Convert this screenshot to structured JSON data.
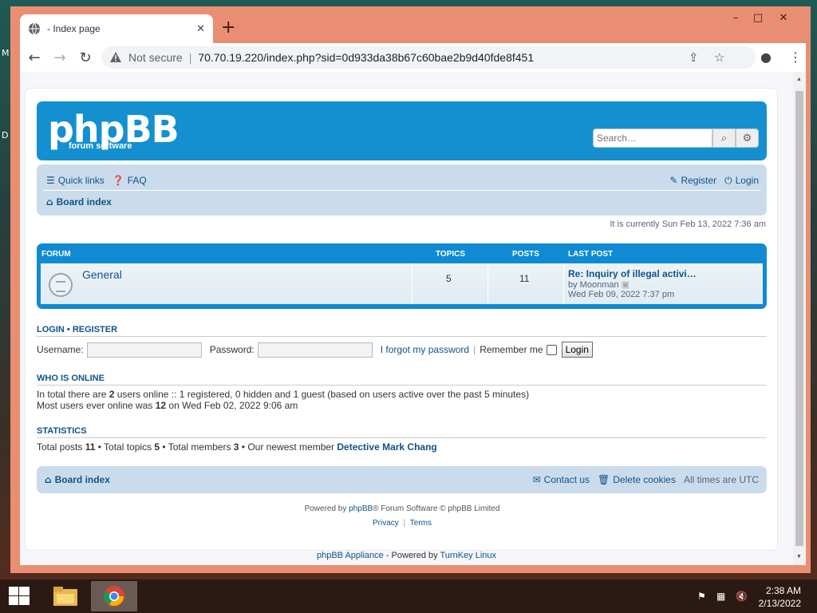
{
  "desktop": {
    "letters": [
      "M",
      "D"
    ]
  },
  "browser": {
    "tab_title": "- Index page",
    "security_label": "Not secure",
    "url": "70.70.19.220/index.php?sid=0d933da38b67c60bae2b9d40fde8f451",
    "window_controls": {
      "minimize": "–",
      "maximize": "□",
      "close": "✕"
    }
  },
  "header": {
    "logo_text": "phpBB",
    "logo_sub": "forum  software",
    "search_placeholder": "Search…"
  },
  "navbar": {
    "quick_links": "Quick links",
    "faq": "FAQ",
    "register": "Register",
    "login": "Login",
    "board_index": "Board index"
  },
  "current_time": "It is currently Sun Feb 13, 2022 7:36 am",
  "forum_table": {
    "headers": {
      "forum": "FORUM",
      "topics": "TOPICS",
      "posts": "POSTS",
      "last_post": "LAST POST"
    },
    "rows": [
      {
        "name": "General",
        "topics": "5",
        "posts": "11",
        "last_post_title": "Re: Inquiry of illegal activi…",
        "last_post_by": "by Moonman",
        "last_post_date": "Wed Feb 09, 2022 7:37 pm"
      }
    ]
  },
  "login_section": {
    "title_login": "LOGIN",
    "bullet": "•",
    "title_register": "REGISTER",
    "username_label": "Username:",
    "password_label": "Password:",
    "forgot": "I forgot my password",
    "divider": "|",
    "remember": "Remember me",
    "login_button": "Login"
  },
  "who_is_online": {
    "title": "WHO IS ONLINE",
    "line1_a": "In total there are ",
    "line1_count": "2",
    "line1_b": " users online :: 1 registered, 0 hidden and 1 guest (based on users active over the past 5 minutes)",
    "line2_a": "Most users ever online was ",
    "line2_count": "12",
    "line2_b": " on Wed Feb 02, 2022 9:06 am"
  },
  "statistics": {
    "title": "STATISTICS",
    "posts_label": "Total posts ",
    "posts": "11",
    "topics_label": " • Total topics ",
    "topics": "5",
    "members_label": " • Total members ",
    "members": "3",
    "newest_label": " • Our newest member ",
    "newest_member": "Detective Mark Chang"
  },
  "footer": {
    "board_index": "Board index",
    "contact": "Contact us",
    "delete_cookies": "Delete cookies",
    "timezone": "All times are UTC",
    "powered_a": "Powered by ",
    "powered_link": "phpBB",
    "powered_b": "® Forum Software © phpBB Limited",
    "privacy": "Privacy",
    "sep": "|",
    "terms": "Terms",
    "appliance": "phpBB Appliance",
    "appliance_mid": " - Powered by ",
    "turnkey": "TurnKey Linux"
  },
  "taskbar": {
    "time": "2:38 AM",
    "date": "2/13/2022"
  },
  "colors": {
    "accent": "#105289",
    "header_blue": "#1490d0",
    "nav_bg": "#cadceb",
    "window_frame": "#e98e72"
  }
}
